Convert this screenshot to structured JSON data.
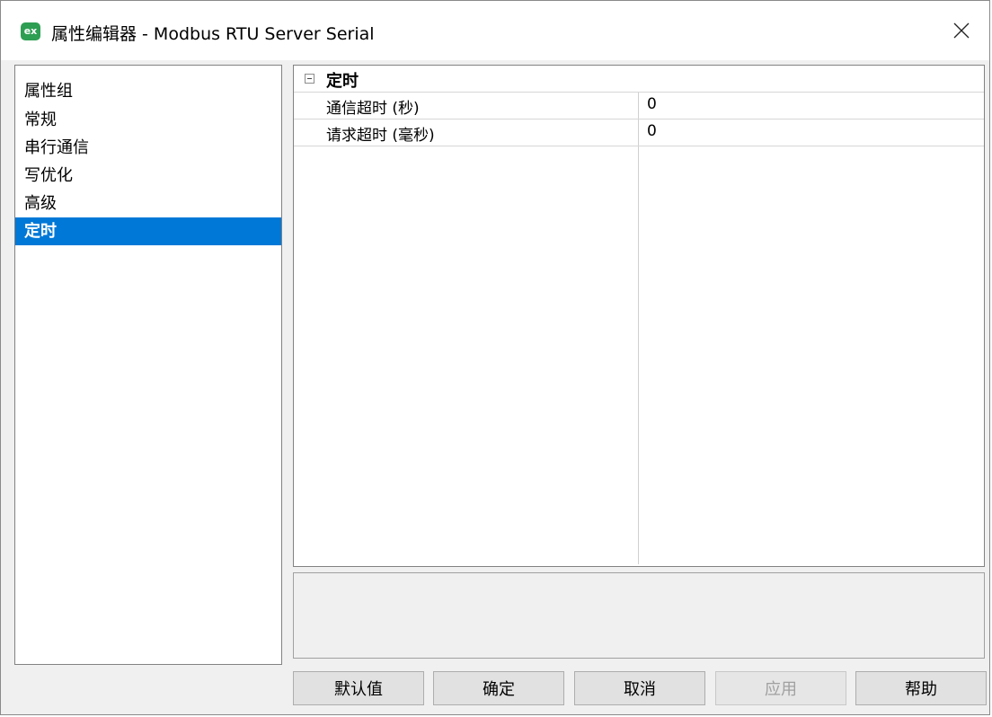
{
  "window": {
    "icon_text": "ex",
    "title": "属性编辑器 - Modbus RTU Server Serial"
  },
  "sidebar": {
    "header": "属性组",
    "items": [
      {
        "label": "常规"
      },
      {
        "label": "串行通信"
      },
      {
        "label": "写优化"
      },
      {
        "label": "高级"
      },
      {
        "label": "定时",
        "selected": true
      }
    ]
  },
  "grid": {
    "category": "定时",
    "properties": [
      {
        "name": "通信超时 (秒)",
        "value": "0"
      },
      {
        "name": "请求超时 (毫秒)",
        "value": "0"
      }
    ]
  },
  "buttons": {
    "default": "默认值",
    "ok": "确定",
    "cancel": "取消",
    "apply": "应用",
    "help": "帮助"
  },
  "colors": {
    "selection": "#0078d7",
    "app_icon": "#2e9e52"
  }
}
